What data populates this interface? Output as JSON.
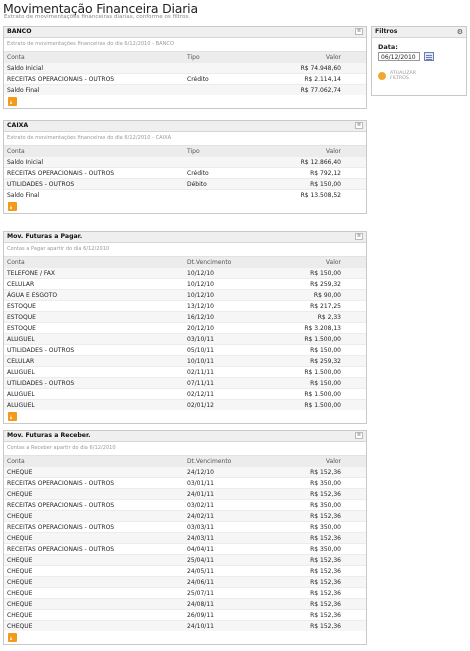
{
  "page": {
    "title": "Movimentação Financeira Diaria",
    "subtitle": "Extrato de movimentações financeiras diarias, conforme os filtros."
  },
  "filters": {
    "title": "Filtros",
    "date_label": "Data:",
    "date_value": "06/12/2010",
    "update_button": "ATUALIZAR FILTROS"
  },
  "panels": [
    {
      "title": "BANCO",
      "description": "Extrato de movimentações financeiras do dia 6/12/2010 - BANCO",
      "columns": [
        "Conta",
        "Tipo",
        "Valor"
      ],
      "rows": [
        [
          "Saldo Inicial",
          "",
          "R$ 74.948,60"
        ],
        [
          "RECEITAS OPERACIONAIS - OUTROS",
          "Crédito",
          "R$ 2.114,14"
        ],
        [
          "Saldo Final",
          "",
          "R$ 77.062,74"
        ]
      ]
    },
    {
      "title": "CAIXA",
      "description": "Extrato de movimentações financeiras do dia 6/12/2010 - CAIXA",
      "columns": [
        "Conta",
        "Tipo",
        "Valor"
      ],
      "rows": [
        [
          "Saldo Inicial",
          "",
          "R$ 12.866,40"
        ],
        [
          "RECEITAS OPERACIONAIS - OUTROS",
          "Crédito",
          "R$ 792,12"
        ],
        [
          "UTILIDADES - OUTROS",
          "Débito",
          "R$ 150,00"
        ],
        [
          "Saldo Final",
          "",
          "R$ 13.508,52"
        ]
      ]
    },
    {
      "title": "Mov. Futuras a Pagar.",
      "description": "Contas a Pagar apartir do dia 6/12/2010",
      "columns": [
        "Conta",
        "Dt.Vencimento",
        "Valor"
      ],
      "rows": [
        [
          "TELEFONE / FAX",
          "10/12/10",
          "R$ 150,00"
        ],
        [
          "CELULAR",
          "10/12/10",
          "R$ 259,32"
        ],
        [
          "ÁGUA E ESGOTO",
          "10/12/10",
          "R$ 90,00"
        ],
        [
          "ESTOQUE",
          "13/12/10",
          "R$ 217,25"
        ],
        [
          "ESTOQUE",
          "16/12/10",
          "R$ 2,33"
        ],
        [
          "ESTOQUE",
          "20/12/10",
          "R$ 3.208,13"
        ],
        [
          "ALUGUEL",
          "03/10/11",
          "R$ 1.500,00"
        ],
        [
          "UTILIDADES - OUTROS",
          "05/10/11",
          "R$ 150,00"
        ],
        [
          "CELULAR",
          "10/10/11",
          "R$ 259,32"
        ],
        [
          "ALUGUEL",
          "02/11/11",
          "R$ 1.500,00"
        ],
        [
          "UTILIDADES - OUTROS",
          "07/11/11",
          "R$ 150,00"
        ],
        [
          "ALUGUEL",
          "02/12/11",
          "R$ 1.500,00"
        ],
        [
          "ALUGUEL",
          "02/01/12",
          "R$ 1.500,00"
        ]
      ]
    },
    {
      "title": "Mov. Futuras a Receber.",
      "description": "Contas a Receber apartir do dia 6/12/2010",
      "columns": [
        "Conta",
        "Dt.Vencimento",
        "Valor"
      ],
      "rows": [
        [
          "CHEQUE",
          "24/12/10",
          "R$ 152,36"
        ],
        [
          "RECEITAS OPERACIONAIS - OUTROS",
          "03/01/11",
          "R$ 350,00"
        ],
        [
          "CHEQUE",
          "24/01/11",
          "R$ 152,36"
        ],
        [
          "RECEITAS OPERACIONAIS - OUTROS",
          "03/02/11",
          "R$ 350,00"
        ],
        [
          "CHEQUE",
          "24/02/11",
          "R$ 152,36"
        ],
        [
          "RECEITAS OPERACIONAIS - OUTROS",
          "03/03/11",
          "R$ 350,00"
        ],
        [
          "CHEQUE",
          "24/03/11",
          "R$ 152,36"
        ],
        [
          "RECEITAS OPERACIONAIS - OUTROS",
          "04/04/11",
          "R$ 350,00"
        ],
        [
          "CHEQUE",
          "25/04/11",
          "R$ 152,36"
        ],
        [
          "CHEQUE",
          "24/05/11",
          "R$ 152,36"
        ],
        [
          "CHEQUE",
          "24/06/11",
          "R$ 152,36"
        ],
        [
          "CHEQUE",
          "25/07/11",
          "R$ 152,36"
        ],
        [
          "CHEQUE",
          "24/08/11",
          "R$ 152,36"
        ],
        [
          "CHEQUE",
          "26/09/11",
          "R$ 152,36"
        ],
        [
          "CHEQUE",
          "24/10/11",
          "R$ 152,36"
        ]
      ]
    }
  ]
}
